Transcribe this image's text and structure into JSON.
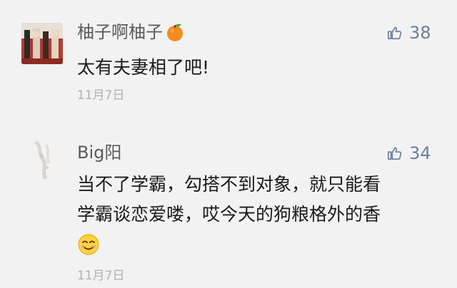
{
  "comments": [
    {
      "username": "柚子啊柚子",
      "name_emoji": "orange-icon",
      "likes": "38",
      "text_lines": [
        "太有夫妻相了吧!"
      ],
      "date": "11月7日"
    },
    {
      "username": "Big阳",
      "likes": "34",
      "text_lines": [
        "当不了学霸，勾搭不到对象，就只能看",
        "学霸谈恋爱喽，哎今天的狗粮格外的香"
      ],
      "text_emoji": "smile-emoji-icon",
      "date": "11月7日"
    }
  ],
  "colors": {
    "background": "#f2f2f2",
    "username": "#5a5a5a",
    "like": "#6b7f9a",
    "date": "#b0b0b0"
  }
}
